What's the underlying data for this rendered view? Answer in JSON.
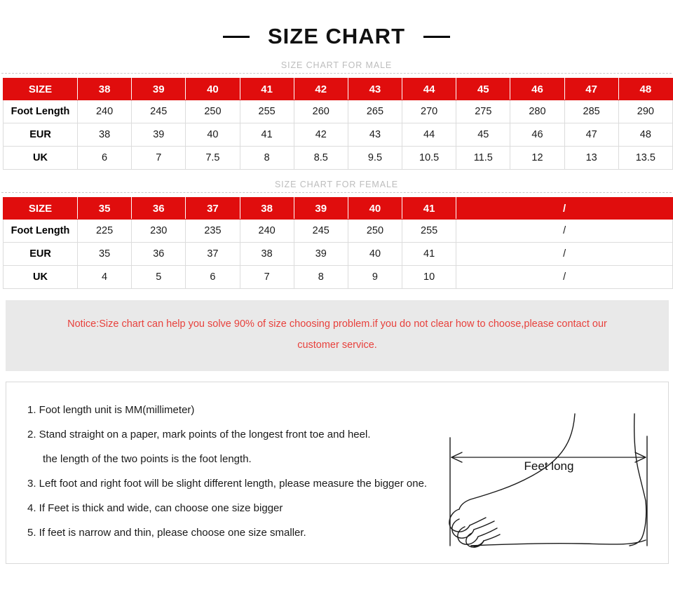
{
  "title": {
    "text": "SIZE CHART",
    "left_dash": "decorative-dash",
    "right_dash": "decorative-dash"
  },
  "male_section": {
    "caption": "SIZE CHART FOR MALE",
    "columns": [
      "SIZE",
      "38",
      "39",
      "40",
      "41",
      "42",
      "43",
      "44",
      "45",
      "46",
      "47",
      "48"
    ],
    "rows": [
      {
        "label": "Foot Length",
        "values": [
          "240",
          "245",
          "250",
          "255",
          "260",
          "265",
          "270",
          "275",
          "280",
          "285",
          "290"
        ]
      },
      {
        "label": "EUR",
        "values": [
          "38",
          "39",
          "40",
          "41",
          "42",
          "43",
          "44",
          "45",
          "46",
          "47",
          "48"
        ]
      },
      {
        "label": "UK",
        "values": [
          "6",
          "7",
          "7.5",
          "8",
          "8.5",
          "9.5",
          "10.5",
          "11.5",
          "12",
          "13",
          "13.5"
        ]
      }
    ]
  },
  "female_section": {
    "caption": "SIZE CHART FOR FEMALE",
    "columns": [
      "SIZE",
      "35",
      "36",
      "37",
      "38",
      "39",
      "40",
      "41"
    ],
    "merged_column_header": "/",
    "merged_column_span": 4,
    "rows": [
      {
        "label": "Foot Length",
        "values": [
          "225",
          "230",
          "235",
          "240",
          "245",
          "250",
          "255"
        ],
        "merged_value": "/"
      },
      {
        "label": "EUR",
        "values": [
          "35",
          "36",
          "37",
          "38",
          "39",
          "40",
          "41"
        ],
        "merged_value": "/"
      },
      {
        "label": "UK",
        "values": [
          "4",
          "5",
          "6",
          "7",
          "8",
          "9",
          "10"
        ],
        "merged_value": "/"
      }
    ]
  },
  "notice": {
    "line1": "Notice:Size chart can help you solve 90% of size choosing problem.if you do not clear how to choose,please contact our",
    "line2": "customer service."
  },
  "instructions": [
    "1. Foot length unit is MM(millimeter)",
    "2. Stand straight on a paper, mark points of the longest front toe and heel.",
    "the length of the two points is the foot length.",
    "3. Left foot and right foot will be slight different length, please measure the bigger one.",
    "4. If Feet is thick and wide, can choose one size bigger",
    "5. If feet is narrow and thin, please choose one size smaller."
  ],
  "figure": {
    "label": "Feet long",
    "icon": "foot-side-profile-icon"
  },
  "colors": {
    "header_red": "#e00d0d",
    "notice_red": "#e8413c",
    "notice_bg": "#e9e9e9",
    "caption_gray": "#bdbdbd",
    "border_gray": "#d9d9d9"
  }
}
